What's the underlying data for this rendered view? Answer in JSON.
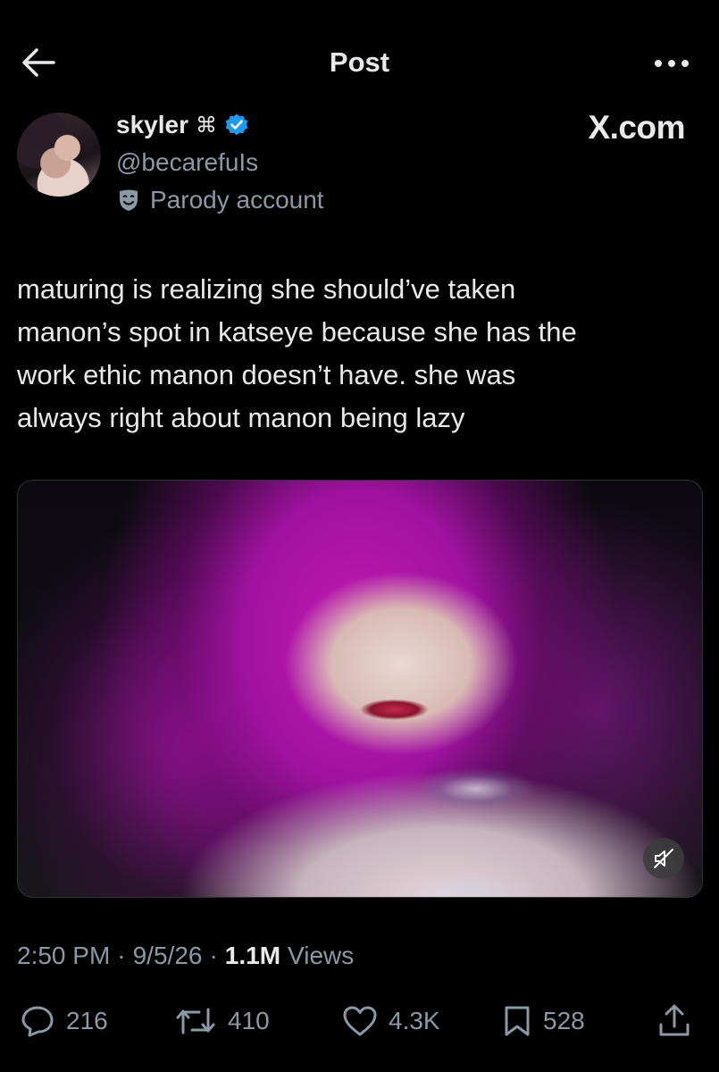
{
  "header": {
    "title": "Post"
  },
  "author": {
    "display_name": "skyler",
    "name_symbol": "⌘",
    "handle": "@becarefuIs",
    "verified": true,
    "label": "Parody account",
    "source_label": "X.com"
  },
  "tweet": {
    "text": "maturing is realizing she should’ve taken\nmanon’s spot in katseye because she has the\nwork ethic manon doesn’t have. she was\nalways right about manon being lazy",
    "time": "2:50 PM",
    "date": "9/5/26",
    "views_count": "1.1M",
    "views_label": "Views",
    "separator": "·"
  },
  "actions": {
    "replies": "216",
    "reposts": "410",
    "likes": "4.3K",
    "bookmarks": "528"
  },
  "colors": {
    "background": "#000000",
    "text_primary": "#e7e9ea",
    "text_secondary": "#8b98a5",
    "verified_blue": "#1d9bf0"
  }
}
